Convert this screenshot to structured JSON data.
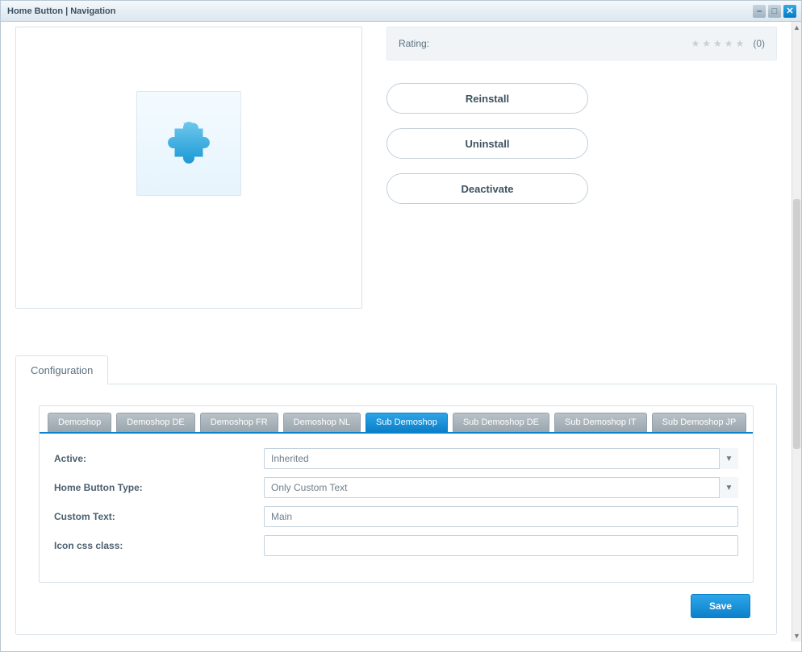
{
  "window": {
    "title": "Home Button | Navigation"
  },
  "rating": {
    "label": "Rating:",
    "count": "(0)"
  },
  "actions": {
    "reinstall": "Reinstall",
    "uninstall": "Uninstall",
    "deactivate": "Deactivate",
    "save": "Save"
  },
  "config": {
    "tab_label": "Configuration"
  },
  "shop_tabs": [
    "Demoshop",
    "Demoshop DE",
    "Demoshop FR",
    "Demoshop NL",
    "Sub Demoshop",
    "Sub Demoshop DE",
    "Sub Demoshop IT",
    "Sub Demoshop JP"
  ],
  "form": {
    "active_label": "Active:",
    "active_value": "Inherited",
    "type_label": "Home Button Type:",
    "type_value": "Only Custom Text",
    "custom_label": "Custom Text:",
    "custom_value": "Main",
    "icon_label": "Icon css class:",
    "icon_value": ""
  }
}
